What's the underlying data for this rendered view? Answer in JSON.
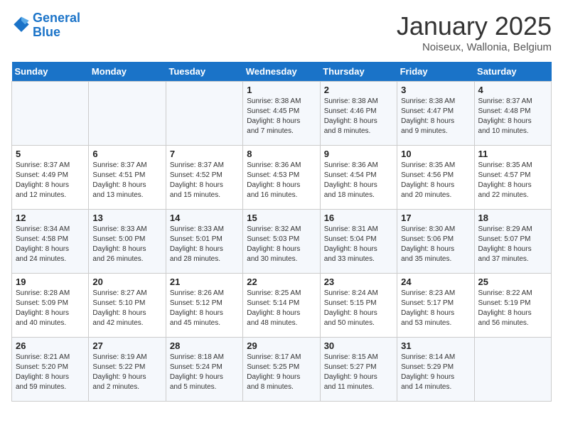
{
  "header": {
    "logo_line1": "General",
    "logo_line2": "Blue",
    "month": "January 2025",
    "location": "Noiseux, Wallonia, Belgium"
  },
  "weekdays": [
    "Sunday",
    "Monday",
    "Tuesday",
    "Wednesday",
    "Thursday",
    "Friday",
    "Saturday"
  ],
  "weeks": [
    [
      {
        "day": "",
        "text": ""
      },
      {
        "day": "",
        "text": ""
      },
      {
        "day": "",
        "text": ""
      },
      {
        "day": "1",
        "text": "Sunrise: 8:38 AM\nSunset: 4:45 PM\nDaylight: 8 hours\nand 7 minutes."
      },
      {
        "day": "2",
        "text": "Sunrise: 8:38 AM\nSunset: 4:46 PM\nDaylight: 8 hours\nand 8 minutes."
      },
      {
        "day": "3",
        "text": "Sunrise: 8:38 AM\nSunset: 4:47 PM\nDaylight: 8 hours\nand 9 minutes."
      },
      {
        "day": "4",
        "text": "Sunrise: 8:37 AM\nSunset: 4:48 PM\nDaylight: 8 hours\nand 10 minutes."
      }
    ],
    [
      {
        "day": "5",
        "text": "Sunrise: 8:37 AM\nSunset: 4:49 PM\nDaylight: 8 hours\nand 12 minutes."
      },
      {
        "day": "6",
        "text": "Sunrise: 8:37 AM\nSunset: 4:51 PM\nDaylight: 8 hours\nand 13 minutes."
      },
      {
        "day": "7",
        "text": "Sunrise: 8:37 AM\nSunset: 4:52 PM\nDaylight: 8 hours\nand 15 minutes."
      },
      {
        "day": "8",
        "text": "Sunrise: 8:36 AM\nSunset: 4:53 PM\nDaylight: 8 hours\nand 16 minutes."
      },
      {
        "day": "9",
        "text": "Sunrise: 8:36 AM\nSunset: 4:54 PM\nDaylight: 8 hours\nand 18 minutes."
      },
      {
        "day": "10",
        "text": "Sunrise: 8:35 AM\nSunset: 4:56 PM\nDaylight: 8 hours\nand 20 minutes."
      },
      {
        "day": "11",
        "text": "Sunrise: 8:35 AM\nSunset: 4:57 PM\nDaylight: 8 hours\nand 22 minutes."
      }
    ],
    [
      {
        "day": "12",
        "text": "Sunrise: 8:34 AM\nSunset: 4:58 PM\nDaylight: 8 hours\nand 24 minutes."
      },
      {
        "day": "13",
        "text": "Sunrise: 8:33 AM\nSunset: 5:00 PM\nDaylight: 8 hours\nand 26 minutes."
      },
      {
        "day": "14",
        "text": "Sunrise: 8:33 AM\nSunset: 5:01 PM\nDaylight: 8 hours\nand 28 minutes."
      },
      {
        "day": "15",
        "text": "Sunrise: 8:32 AM\nSunset: 5:03 PM\nDaylight: 8 hours\nand 30 minutes."
      },
      {
        "day": "16",
        "text": "Sunrise: 8:31 AM\nSunset: 5:04 PM\nDaylight: 8 hours\nand 33 minutes."
      },
      {
        "day": "17",
        "text": "Sunrise: 8:30 AM\nSunset: 5:06 PM\nDaylight: 8 hours\nand 35 minutes."
      },
      {
        "day": "18",
        "text": "Sunrise: 8:29 AM\nSunset: 5:07 PM\nDaylight: 8 hours\nand 37 minutes."
      }
    ],
    [
      {
        "day": "19",
        "text": "Sunrise: 8:28 AM\nSunset: 5:09 PM\nDaylight: 8 hours\nand 40 minutes."
      },
      {
        "day": "20",
        "text": "Sunrise: 8:27 AM\nSunset: 5:10 PM\nDaylight: 8 hours\nand 42 minutes."
      },
      {
        "day": "21",
        "text": "Sunrise: 8:26 AM\nSunset: 5:12 PM\nDaylight: 8 hours\nand 45 minutes."
      },
      {
        "day": "22",
        "text": "Sunrise: 8:25 AM\nSunset: 5:14 PM\nDaylight: 8 hours\nand 48 minutes."
      },
      {
        "day": "23",
        "text": "Sunrise: 8:24 AM\nSunset: 5:15 PM\nDaylight: 8 hours\nand 50 minutes."
      },
      {
        "day": "24",
        "text": "Sunrise: 8:23 AM\nSunset: 5:17 PM\nDaylight: 8 hours\nand 53 minutes."
      },
      {
        "day": "25",
        "text": "Sunrise: 8:22 AM\nSunset: 5:19 PM\nDaylight: 8 hours\nand 56 minutes."
      }
    ],
    [
      {
        "day": "26",
        "text": "Sunrise: 8:21 AM\nSunset: 5:20 PM\nDaylight: 8 hours\nand 59 minutes."
      },
      {
        "day": "27",
        "text": "Sunrise: 8:19 AM\nSunset: 5:22 PM\nDaylight: 9 hours\nand 2 minutes."
      },
      {
        "day": "28",
        "text": "Sunrise: 8:18 AM\nSunset: 5:24 PM\nDaylight: 9 hours\nand 5 minutes."
      },
      {
        "day": "29",
        "text": "Sunrise: 8:17 AM\nSunset: 5:25 PM\nDaylight: 9 hours\nand 8 minutes."
      },
      {
        "day": "30",
        "text": "Sunrise: 8:15 AM\nSunset: 5:27 PM\nDaylight: 9 hours\nand 11 minutes."
      },
      {
        "day": "31",
        "text": "Sunrise: 8:14 AM\nSunset: 5:29 PM\nDaylight: 9 hours\nand 14 minutes."
      },
      {
        "day": "",
        "text": ""
      }
    ]
  ]
}
